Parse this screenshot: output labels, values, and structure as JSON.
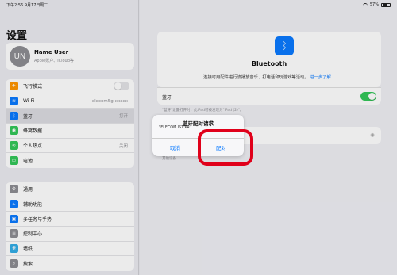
{
  "status": {
    "time": "下午2:56",
    "date": "9月17日周二",
    "battery": "57%"
  },
  "sidebar": {
    "title": "设置",
    "profile": {
      "initials": "UN",
      "name": "Name User",
      "subtitle": "Apple账户、iCloud等"
    },
    "group1": [
      {
        "label": "飞行模式",
        "icon": "airplane-icon",
        "color": "#ff9500",
        "glyph": "✈",
        "toggle": false
      },
      {
        "label": "Wi-Fi",
        "icon": "wifi-icon",
        "color": "#0a7aff",
        "glyph": "≋",
        "value": "elecom5g-xxxxx"
      },
      {
        "label": "蓝牙",
        "icon": "bluetooth-icon",
        "color": "#0a7aff",
        "glyph": "ᛒ",
        "value": "打开",
        "selected": true
      },
      {
        "label": "蜂窝数据",
        "icon": "cellular-icon",
        "color": "#34c759",
        "glyph": "◉"
      },
      {
        "label": "个人热点",
        "icon": "hotspot-icon",
        "color": "#34c759",
        "glyph": "∞",
        "value": "关闭"
      },
      {
        "label": "电池",
        "icon": "battery-icon",
        "color": "#34c759",
        "glyph": "▭"
      }
    ],
    "group2": [
      {
        "label": "通用",
        "icon": "gear-icon",
        "color": "#8e8e93",
        "glyph": "⚙"
      },
      {
        "label": "辅助功能",
        "icon": "accessibility-icon",
        "color": "#0a7aff",
        "glyph": "♿"
      },
      {
        "label": "多任务与手势",
        "icon": "multitasking-icon",
        "color": "#0a7aff",
        "glyph": "▣"
      },
      {
        "label": "控制中心",
        "icon": "control-center-icon",
        "color": "#8e8e93",
        "glyph": "≡"
      },
      {
        "label": "墙纸",
        "icon": "wallpaper-icon",
        "color": "#32ade6",
        "glyph": "❋"
      },
      {
        "label": "搜索",
        "icon": "search-icon",
        "color": "#8e8e93",
        "glyph": "⌕"
      }
    ]
  },
  "detail": {
    "bt_logo": "ᛒ",
    "bt_title": "Bluetooth",
    "bt_desc": "连接可用配件进行流播放音乐、打电话和玩游戏等活动。",
    "bt_link": "进一步了解...",
    "toggle_label": "蓝牙",
    "toggle_on": true,
    "discover_note": "\"蓝牙\"设置打开时，此iPad可被发现为\"iPad (2)\"。",
    "other_label": "其他设备"
  },
  "dialog": {
    "title": "蓝牙配对请求",
    "message": "\"ELECOM IST PR...",
    "cancel": "取消",
    "pair": "配对"
  },
  "colors": {
    "accent": "#0a7aff",
    "toggle_on": "#34c759",
    "highlight": "#e0001a"
  }
}
